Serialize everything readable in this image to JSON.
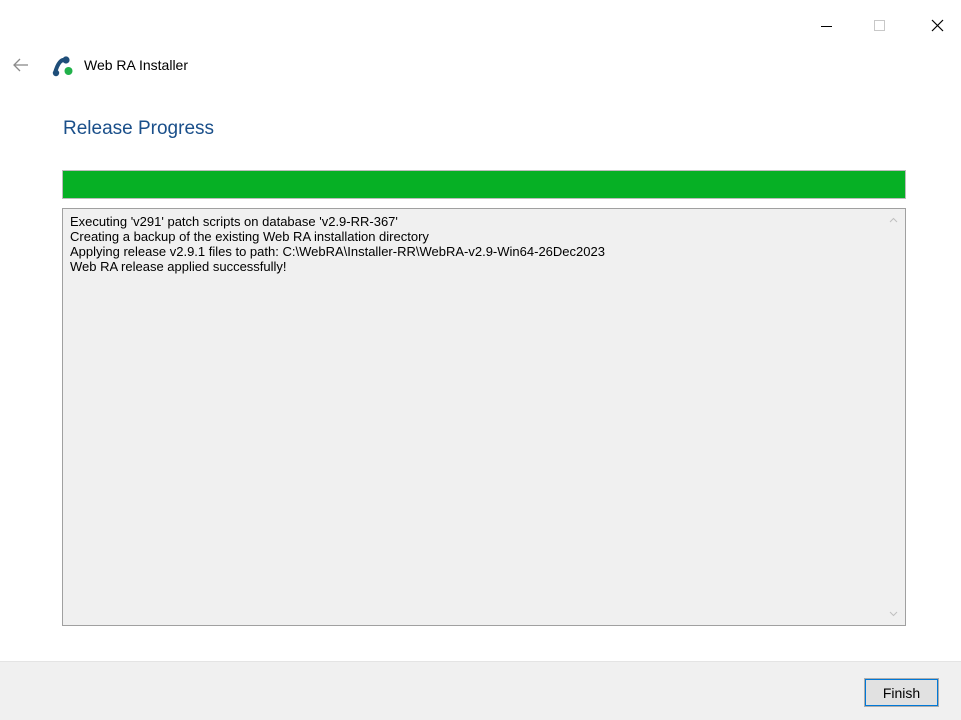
{
  "window": {
    "title": "Web RA Installer",
    "controls": {
      "minimize": "minimize-icon",
      "maximize": "maximize-icon",
      "close": "close-icon"
    }
  },
  "icons": {
    "back": "back-arrow-icon",
    "logo": "web-ra-logo-icon"
  },
  "page": {
    "heading": "Release Progress"
  },
  "progress": {
    "percent": 100,
    "color": "#06b025"
  },
  "log": {
    "lines": [
      "Executing 'v291' patch scripts on database 'v2.9-RR-367'",
      "Creating a backup of the existing Web RA installation directory",
      "Applying release v2.9.1 files to path: C:\\WebRA\\Installer-RR\\WebRA-v2.9-Win64-26Dec2023",
      "Web RA release applied successfully!"
    ]
  },
  "footer": {
    "finish_label": "Finish"
  },
  "colors": {
    "heading": "#1a4f8a",
    "progress": "#06b025",
    "logo_blue": "#1f4e79",
    "logo_green": "#21b14a"
  }
}
